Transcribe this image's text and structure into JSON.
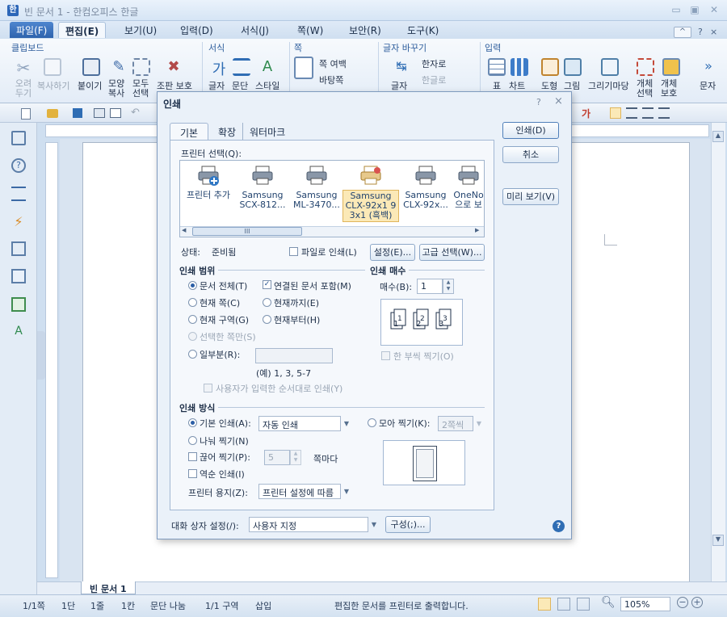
{
  "window": {
    "title": "빈 문서 1 - 한컴오피스 한글",
    "controls": {
      "minimize": "▭",
      "restore": "▣",
      "close": "✕"
    }
  },
  "menu": {
    "tabs": [
      "파일(F)",
      "편집(E)",
      "보기(U)",
      "입력(D)",
      "서식(J)",
      "쪽(W)",
      "보안(R)",
      "도구(K)"
    ],
    "right": {
      "collapse": "^",
      "help": "?",
      "close": "×"
    }
  },
  "ribbon": {
    "groups": {
      "clipboard": "클립보드",
      "style": "서식",
      "page": "쪽",
      "char_convert": "글자 바꾸기",
      "input": "입력"
    },
    "buttons": {
      "cut": "오려\n두기",
      "copy": "복사하기",
      "paste": "붙이기",
      "shape_copy": "모양\n복사",
      "select_all": "모두\n선택",
      "format_protect": "조판 보호",
      "char": "글자",
      "para": "문단",
      "style": "스타일",
      "page_margin": "쪽 여백",
      "page_bg": "바탕쪽",
      "hanja": "한자로",
      "hangul": "한글로",
      "char2": "글자",
      "table": "표",
      "chart": "차트",
      "shape": "도형",
      "picture": "그림",
      "gallery": "그리기마당",
      "obj_select": "개체\n선택",
      "obj_protect": "개체\n보호",
      "more": "문자"
    }
  },
  "statusbar": {
    "page": "1/1쪽",
    "dan": "1단",
    "line": "1줄",
    "col": "1칸",
    "para_split": "문단 나눔",
    "section": "1/1 구역",
    "insert": "삽입",
    "message": "편집한 문서를 프린터로 출력합니다.",
    "zoom": "105%"
  },
  "doc_tab": "빈 문서 1",
  "dialog": {
    "title": "인쇄",
    "help": "?",
    "close": "×",
    "tabs": [
      "기본",
      "확장",
      "워터마크"
    ],
    "side_buttons": {
      "print": "인쇄(D)",
      "cancel": "취소",
      "preview": "미리 보기(V)"
    },
    "printer_select_label": "프린터 선택(Q):",
    "printers": [
      {
        "name": "프린터 추가",
        "icon": "printer-add-icon"
      },
      {
        "name": "Samsung\nSCX-812...",
        "icon": "printer-icon"
      },
      {
        "name": "Samsung\nML-3470...",
        "icon": "printer-icon"
      },
      {
        "name": "Samsung\nCLX-92x1 9\n3x1 (흑백)",
        "icon": "printer-selected-icon"
      },
      {
        "name": "Samsung\nCLX-92x...",
        "icon": "printer-icon"
      },
      {
        "name": "OneNo\n으로 보",
        "icon": "printer-icon"
      }
    ],
    "scroll_thumb": "III",
    "status_label": "상태:",
    "status_value": "준비됨",
    "print_to_file": "파일로 인쇄(L)",
    "settings_button": "설정(E)...",
    "advanced_button": "고급 선택(W)...",
    "range": {
      "title": "인쇄 범위",
      "all_doc": "문서 전체(T)",
      "linked_doc": "연결된 문서 포함(M)",
      "current_page": "현재 쪽(C)",
      "until_current": "현재까지(E)",
      "current_section": "현재 구역(G)",
      "from_current": "현재부터(H)",
      "selected_pages": "선택한 쪽만(S)",
      "partial": "일부분(R):",
      "example": "(예) 1, 3, 5-7",
      "user_order": "사용자가 입력한 순서대로 인쇄(Y)"
    },
    "copies": {
      "title": "인쇄 매수",
      "label": "매수(B):",
      "value": "1",
      "collate": "한 부씩 찍기(O)"
    },
    "method": {
      "title": "인쇄 방식",
      "basic": "기본 인쇄(A):",
      "basic_value": "자동 인쇄",
      "gather": "모아 찍기(K):",
      "gather_value": "2쪽씩",
      "split": "나눠 찍기(N)",
      "interval": "끊어 찍기(P):",
      "interval_value": "5",
      "interval_unit": "쪽마다",
      "reverse": "역순 인쇄(I)",
      "paper_label": "프린터 용지(Z):",
      "paper_value": "프린터 설정에 따름"
    },
    "dialog_setting_label": "대화 상자 설정(/):",
    "dialog_setting_value": "사용자 지정",
    "compose_button": "구성(;)..."
  }
}
